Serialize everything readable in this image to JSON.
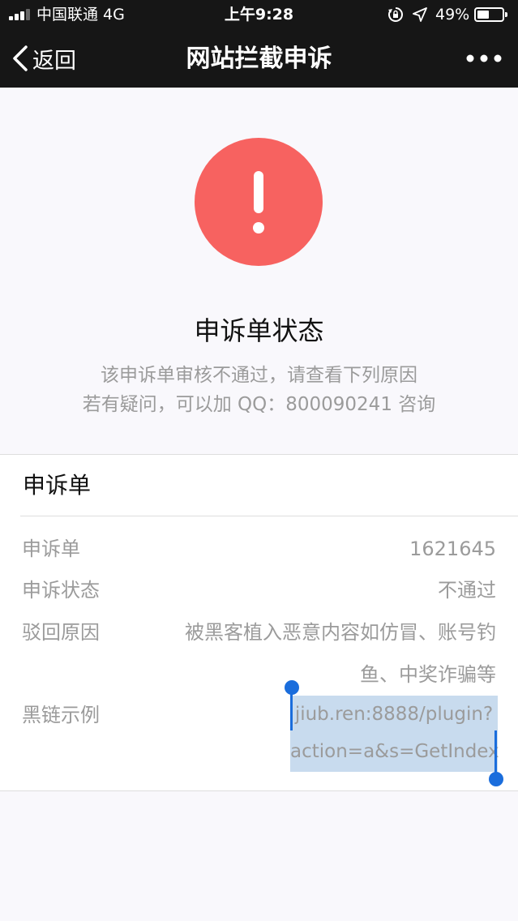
{
  "status_bar": {
    "carrier": "中国联通  4G",
    "time": "上午9:28",
    "battery_percent": "49%",
    "battery_level": 0.49,
    "icons": [
      "signal-icon",
      "rotation-lock-icon",
      "location-arrow-icon",
      "battery-icon"
    ]
  },
  "nav": {
    "back_label": "返回",
    "title": "网站拦截申诉",
    "more_icon": "more-dots-icon"
  },
  "status": {
    "icon": "alert-exclamation-icon",
    "title": "申诉单状态",
    "desc_line1": "该申诉单审核不通过，请查看下列原因",
    "desc_line2": "若有疑问，可以加 QQ：800090241 咨询"
  },
  "form": {
    "title": "申诉单",
    "rows": [
      {
        "label": "申诉单",
        "value": "1621645"
      },
      {
        "label": "申诉状态",
        "value": "不通过"
      },
      {
        "label": "驳回原因",
        "value_line1": "被黑客植入恶意内容如仿冒、账号钓",
        "value_line2": "鱼、中奖诈骗等"
      },
      {
        "label": "黑链示例",
        "value_line1": "jiub.ren:8888/plugin?",
        "value_line2": "action=a&s=GetIndex"
      }
    ]
  },
  "colors": {
    "bar_bg": "#161616",
    "alert": "#f76260",
    "selection": "#c8dbee",
    "selection_handle": "#1a6ddc",
    "muted_text": "#9b9b9b"
  }
}
